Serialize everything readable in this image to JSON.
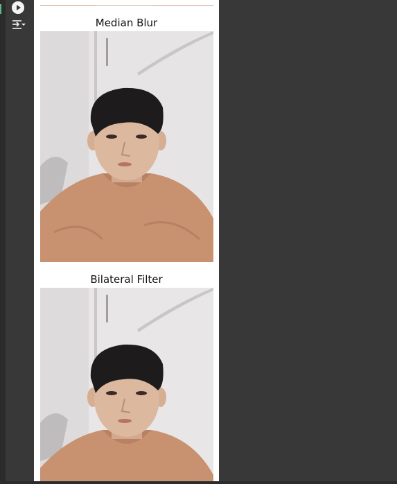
{
  "toolbar": {
    "run_icon": "play-icon",
    "output_icon": "output-settings-icon"
  },
  "output": {
    "figures": [
      {
        "title": "Median Blur"
      },
      {
        "title": "Bilateral Filter"
      }
    ]
  },
  "colors": {
    "background": "#383838",
    "panel": "#ffffff",
    "skin": "#d9b59b",
    "hair": "#1e1b1c",
    "shirt": "#c88f6a",
    "wall": "#e7e5e6"
  }
}
